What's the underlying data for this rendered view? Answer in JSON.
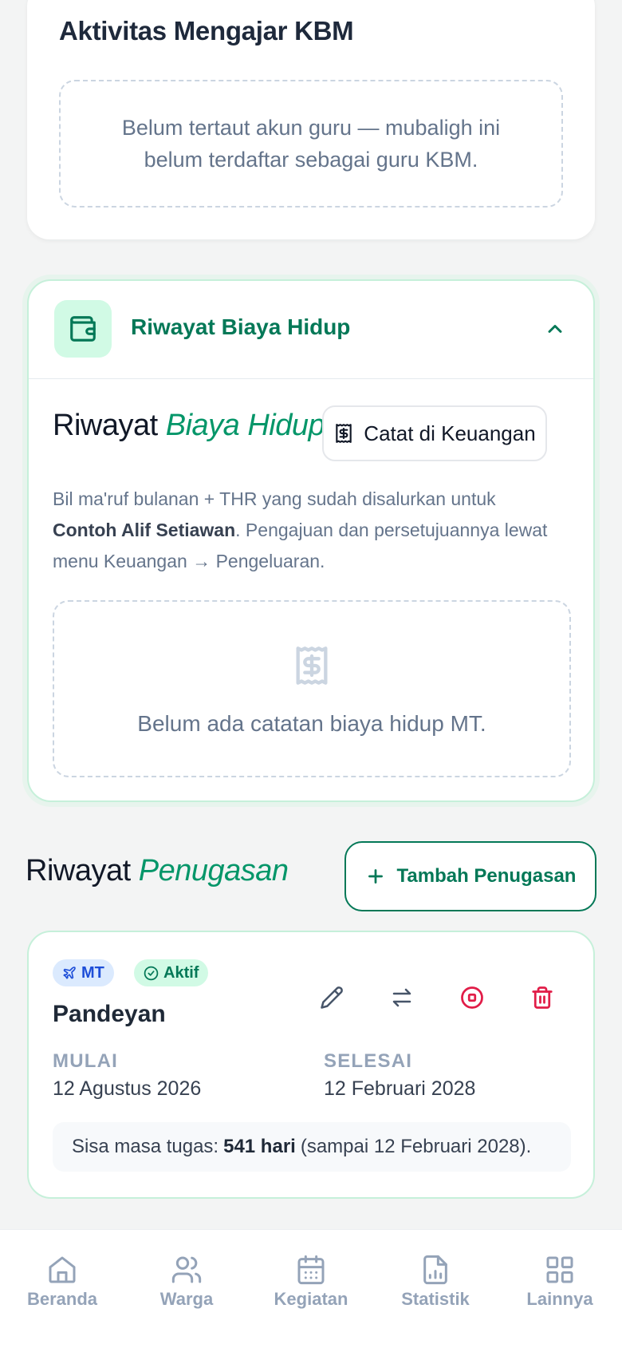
{
  "kbm": {
    "title": "Aktivitas Mengajar KBM",
    "empty_text": "Belum tertaut akun guru — mubaligh ini belum terdaftar sebagai guru KBM."
  },
  "biaya": {
    "header_title": "Riwayat Biaya Hidup",
    "title_plain": "Riwayat",
    "title_accent": "Biaya Hidup",
    "record_button": "Catat di Keuangan",
    "desc_before": "Bil ma'ruf bulanan + THR yang sudah disalurkan untuk",
    "desc_name": "Contoh Alif Setiawan",
    "desc_after": ". Pengajuan dan persetujuannya lewat menu Keuangan → Pengeluaran.",
    "empty_text": "Belum ada catatan biaya hidup MT.",
    "icons": {
      "header": "wallet-icon",
      "button": "receipt-icon",
      "empty": "receipt-icon",
      "collapse": "chevron-up-icon"
    }
  },
  "penugasan": {
    "title_plain": "Riwayat",
    "title_accent": "Penugasan",
    "add_button": "Tambah Penugasan",
    "item": {
      "badge_type": "MT",
      "badge_status": "Aktif",
      "place": "Pandeyan",
      "start_label": "MULAI",
      "start_value": "12 Agustus 2026",
      "end_label": "SELESAI",
      "end_value": "12 Februari 2028",
      "remaining_prefix": "Sisa masa tugas:",
      "remaining_days": "541 hari",
      "remaining_suffix": "(sampai 12 Februari 2028).",
      "actions": [
        "edit-icon",
        "transfer-icon",
        "stop-icon",
        "delete-icon"
      ]
    }
  },
  "nav": [
    {
      "label": "Beranda",
      "icon": "home-icon"
    },
    {
      "label": "Warga",
      "icon": "users-icon"
    },
    {
      "label": "Kegiatan",
      "icon": "calendar-icon"
    },
    {
      "label": "Statistik",
      "icon": "chart-file-icon"
    },
    {
      "label": "Lainnya",
      "icon": "grid-icon"
    }
  ],
  "colors": {
    "accent": "#047857",
    "accent_light": "#d1fae5",
    "danger": "#e11d48",
    "muted": "#94a3b8"
  }
}
